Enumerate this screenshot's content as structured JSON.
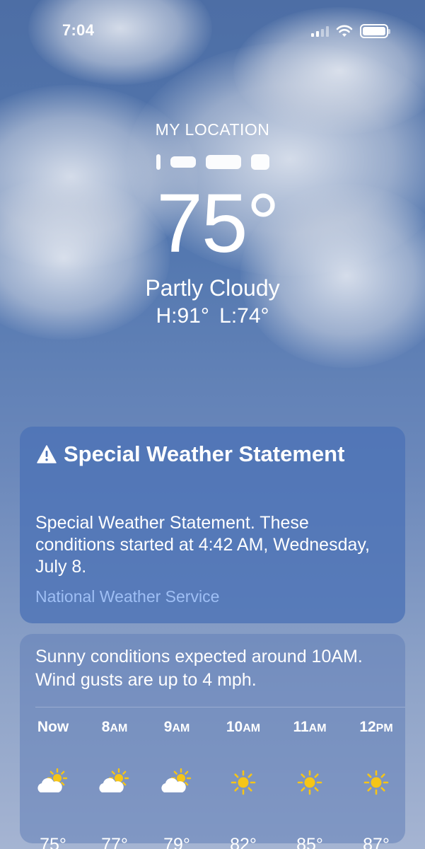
{
  "status_bar": {
    "time": "7:04"
  },
  "header": {
    "location_label": "MY LOCATION",
    "temperature": "75°",
    "condition": "Partly Cloudy",
    "hi_lo": "H:91° L:74°"
  },
  "alert": {
    "title": "Special Weather Statement",
    "body": "Special Weather Statement. These conditions started at 4:42 AM, Wednesday, July 8.",
    "source": "National Weather Service"
  },
  "forecast": {
    "summary": "Sunny conditions expected around 10AM. Wind gusts are up to 4 mph.",
    "hours": [
      {
        "time": "Now",
        "suffix": "",
        "icon": "partly-cloudy-icon",
        "temp": "75°"
      },
      {
        "time": "8",
        "suffix": "AM",
        "icon": "partly-cloudy-icon",
        "temp": "77°"
      },
      {
        "time": "9",
        "suffix": "AM",
        "icon": "partly-cloudy-icon",
        "temp": "79°"
      },
      {
        "time": "10",
        "suffix": "AM",
        "icon": "sun-icon",
        "temp": "82°"
      },
      {
        "time": "11",
        "suffix": "AM",
        "icon": "sun-icon",
        "temp": "85°"
      },
      {
        "time": "12",
        "suffix": "PM",
        "icon": "sun-icon",
        "temp": "87°"
      }
    ]
  },
  "colors": {
    "sky_top": "#4d6ea5",
    "alert_card": "#4c72b6",
    "source_link": "#9fbff5",
    "sun": "#f5c518"
  }
}
